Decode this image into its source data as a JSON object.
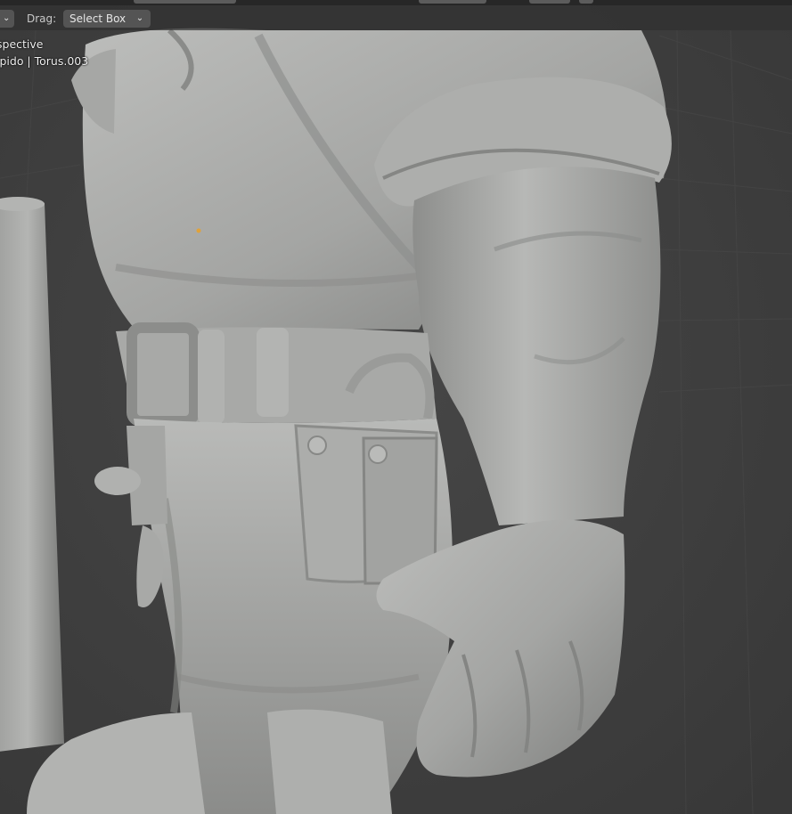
{
  "header": {
    "drag_label": "Drag:",
    "select_mode": "Select Box"
  },
  "viewport_info": {
    "view_name": "spective",
    "object_name": "ipido | Torus.003"
  },
  "icons": {
    "mode_dropdown": "chevron-down-icon",
    "select_dropdown": "chevron-down-icon",
    "origin_point": "object-origin-dot"
  },
  "colors": {
    "viewport_background": "#3d3d3d",
    "header_background": "#303030",
    "clay_material": "#a9aaa8",
    "origin_point": "#e0a23a"
  }
}
